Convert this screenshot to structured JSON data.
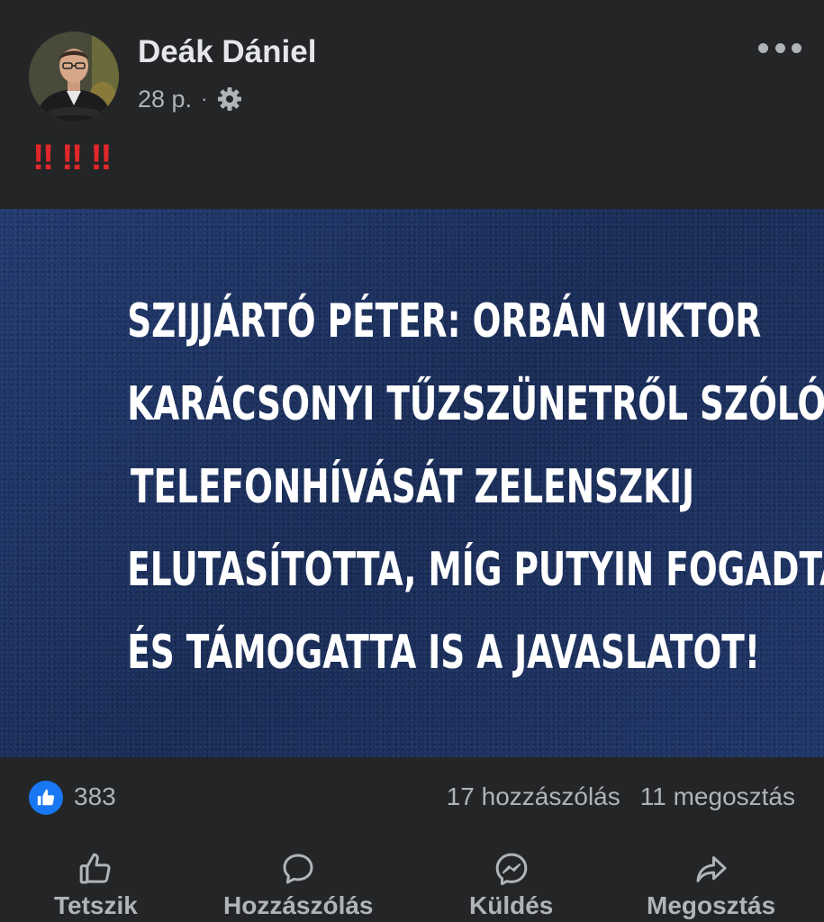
{
  "post": {
    "author": "Deák Dániel",
    "time": "28 p.",
    "separator": "·",
    "audience_icon": "gear-icon",
    "text": [
      "‼",
      "‼",
      "‼"
    ],
    "image_text_lines": [
      "SZIJJÁRTÓ PÉTER: ORBÁN VIKTOR",
      "KARÁCSONYI TŰZSZÜNETRŐL SZÓLÓ",
      "TELEFONHÍVÁSÁT ZELENSZKIJ",
      "ELUTASÍTOTTA, MÍG PUTYIN FOGADTA",
      "ÉS TÁMOGATTA IS A JAVASLATOT!"
    ]
  },
  "stats": {
    "likes": "383",
    "comments": "17 hozzászólás",
    "shares": "11 megosztás"
  },
  "actions": {
    "like": "Tetszik",
    "comment": "Hozzászólás",
    "send": "Küldés",
    "share": "Megosztás"
  },
  "colors": {
    "background": "#242526",
    "text_primary": "#e4e6eb",
    "text_secondary": "#b0b3b8",
    "accent_like": "#1877f2",
    "exclamation": "#e0282b",
    "image_background": "#1b2f5c"
  }
}
